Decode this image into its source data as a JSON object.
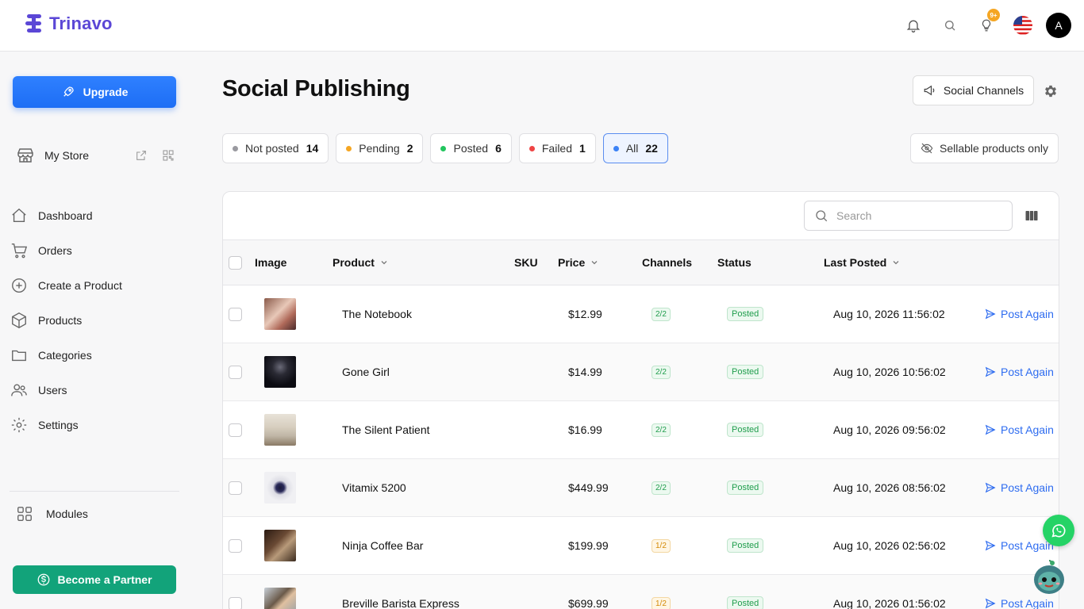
{
  "app": {
    "name": "Trinavo"
  },
  "topbar": {
    "notif_badge": "9+",
    "avatar_initial": "A"
  },
  "sidebar": {
    "upgrade_label": "Upgrade",
    "store_label": "My Store",
    "nav": [
      {
        "label": "Dashboard"
      },
      {
        "label": "Orders"
      },
      {
        "label": "Create a Product"
      },
      {
        "label": "Products"
      },
      {
        "label": "Categories"
      },
      {
        "label": "Users"
      },
      {
        "label": "Settings"
      }
    ],
    "modules_label": "Modules",
    "partner_label": "Become a Partner"
  },
  "page": {
    "title": "Social Publishing",
    "social_channels_label": "Social Channels",
    "sellable_label": "Sellable products only",
    "search_placeholder": "Search"
  },
  "filters": [
    {
      "label": "Not posted",
      "count": "14",
      "color": "#9a9aa0"
    },
    {
      "label": "Pending",
      "count": "2",
      "color": "#f5a623"
    },
    {
      "label": "Posted",
      "count": "6",
      "color": "#22c55e"
    },
    {
      "label": "Failed",
      "count": "1",
      "color": "#ef4444"
    },
    {
      "label": "All",
      "count": "22",
      "color": "#3b82f6"
    }
  ],
  "table": {
    "headers": {
      "image": "Image",
      "product": "Product",
      "sku": "SKU",
      "price": "Price",
      "channels": "Channels",
      "status": "Status",
      "last_posted": "Last Posted"
    },
    "action_label": "Post Again",
    "rows": [
      {
        "product": "The Notebook",
        "price": "$12.99",
        "channels": "2/2",
        "status": "Posted",
        "last_posted": "Aug 10, 2026 11:56:02"
      },
      {
        "product": "Gone Girl",
        "price": "$14.99",
        "channels": "2/2",
        "status": "Posted",
        "last_posted": "Aug 10, 2026 10:56:02"
      },
      {
        "product": "The Silent Patient",
        "price": "$16.99",
        "channels": "2/2",
        "status": "Posted",
        "last_posted": "Aug 10, 2026 09:56:02"
      },
      {
        "product": "Vitamix 5200",
        "price": "$449.99",
        "channels": "2/2",
        "status": "Posted",
        "last_posted": "Aug 10, 2026 08:56:02"
      },
      {
        "product": "Ninja Coffee Bar",
        "price": "$199.99",
        "channels": "1/2",
        "status": "Posted",
        "last_posted": "Aug 10, 2026 02:56:02"
      },
      {
        "product": "Breville Barista Express",
        "price": "$699.99",
        "channels": "1/2",
        "status": "Posted",
        "last_posted": "Aug 10, 2026 01:56:02"
      }
    ]
  }
}
